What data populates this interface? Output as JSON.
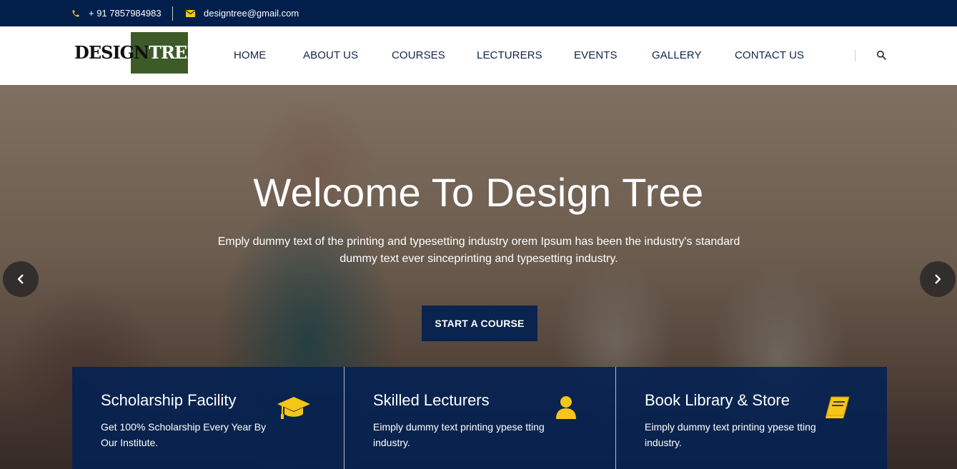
{
  "topbar": {
    "phone": "+ 91 7857984983",
    "email": "designtree@gmail.com"
  },
  "logo": {
    "part1": "DESIGN",
    "part2": "TREE"
  },
  "menu": [
    "HOME",
    "ABOUT US",
    "COURSES",
    "LECTURERS",
    "EVENTS",
    "GALLERY",
    "CONTACT US"
  ],
  "hero": {
    "title": "Welcome To Design Tree",
    "subtitle": "Emply dummy text of the printing and typesetting industry orem Ipsum has been the industry's standard dummy text ever sinceprinting and typesetting industry.",
    "cta": "START A COURSE"
  },
  "features": [
    {
      "title": "Scholarship Facility",
      "text": "Get 100% Scholarship Every Year By Our Institute.",
      "icon": "graduation-cap-icon"
    },
    {
      "title": "Skilled Lecturers",
      "text": "Eimply dummy text printing ypese tting industry.",
      "icon": "user-icon"
    },
    {
      "title": "Book Library & Store",
      "text": "Eimply dummy text printing ypese tting industry.",
      "icon": "book-icon"
    }
  ],
  "colors": {
    "navy": "#021f4b",
    "accent_yellow": "#f5c518",
    "logo_green": "#3d5b28"
  }
}
